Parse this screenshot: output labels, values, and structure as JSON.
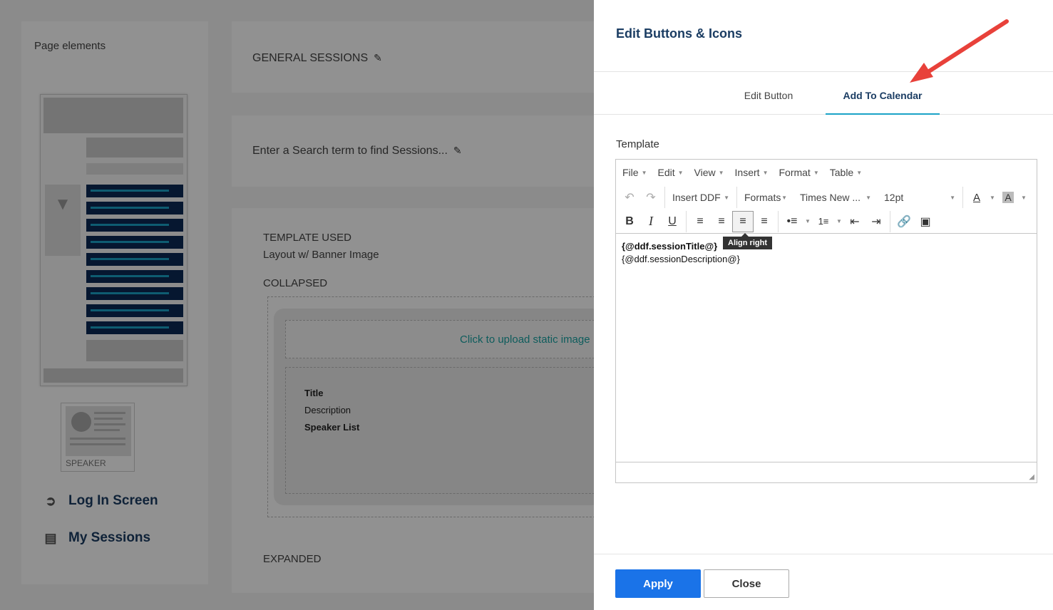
{
  "background": {
    "left_panel": {
      "title": "Page elements",
      "speaker_label": "SPEAKER",
      "nav": [
        {
          "label": "Log In Screen",
          "icon": "login-icon"
        },
        {
          "label": "My Sessions",
          "icon": "basket-icon"
        }
      ]
    },
    "cards": {
      "general_sessions": "GENERAL SESSIONS",
      "search_prompt": "Enter a Search term to find Sessions...",
      "template_used_label": "TEMPLATE USED",
      "template_used_value": "Layout w/ Banner Image",
      "collapsed_label": "COLLAPSED",
      "upload_text": "Click to upload static image",
      "fields": [
        "Title",
        "Description",
        "Speaker List"
      ],
      "expanded_label": "EXPANDED"
    }
  },
  "panel": {
    "title": "Edit Buttons & Icons",
    "tabs": [
      {
        "label": "Edit Button",
        "active": false
      },
      {
        "label": "Add To Calendar",
        "active": true
      }
    ],
    "template_label": "Template",
    "editor": {
      "menus": [
        "File",
        "Edit",
        "View",
        "Insert",
        "Format",
        "Table"
      ],
      "insert_ddf": "Insert DDF",
      "formats": "Formats",
      "font_family": "Times New ...",
      "font_size": "12pt",
      "tooltip": "Align right",
      "content_lines": [
        {
          "text": "{@ddf.sessionTitle@}",
          "bold": true
        },
        {
          "text": "{@ddf.sessionDescription@}",
          "bold": false
        }
      ]
    },
    "buttons": {
      "apply": "Apply",
      "close": "Close"
    }
  },
  "colors": {
    "accent_blue": "#1a73e8",
    "tab_underline": "#1aa3c7",
    "title_navy": "#1b3d63",
    "arrow_red": "#e8413a"
  }
}
